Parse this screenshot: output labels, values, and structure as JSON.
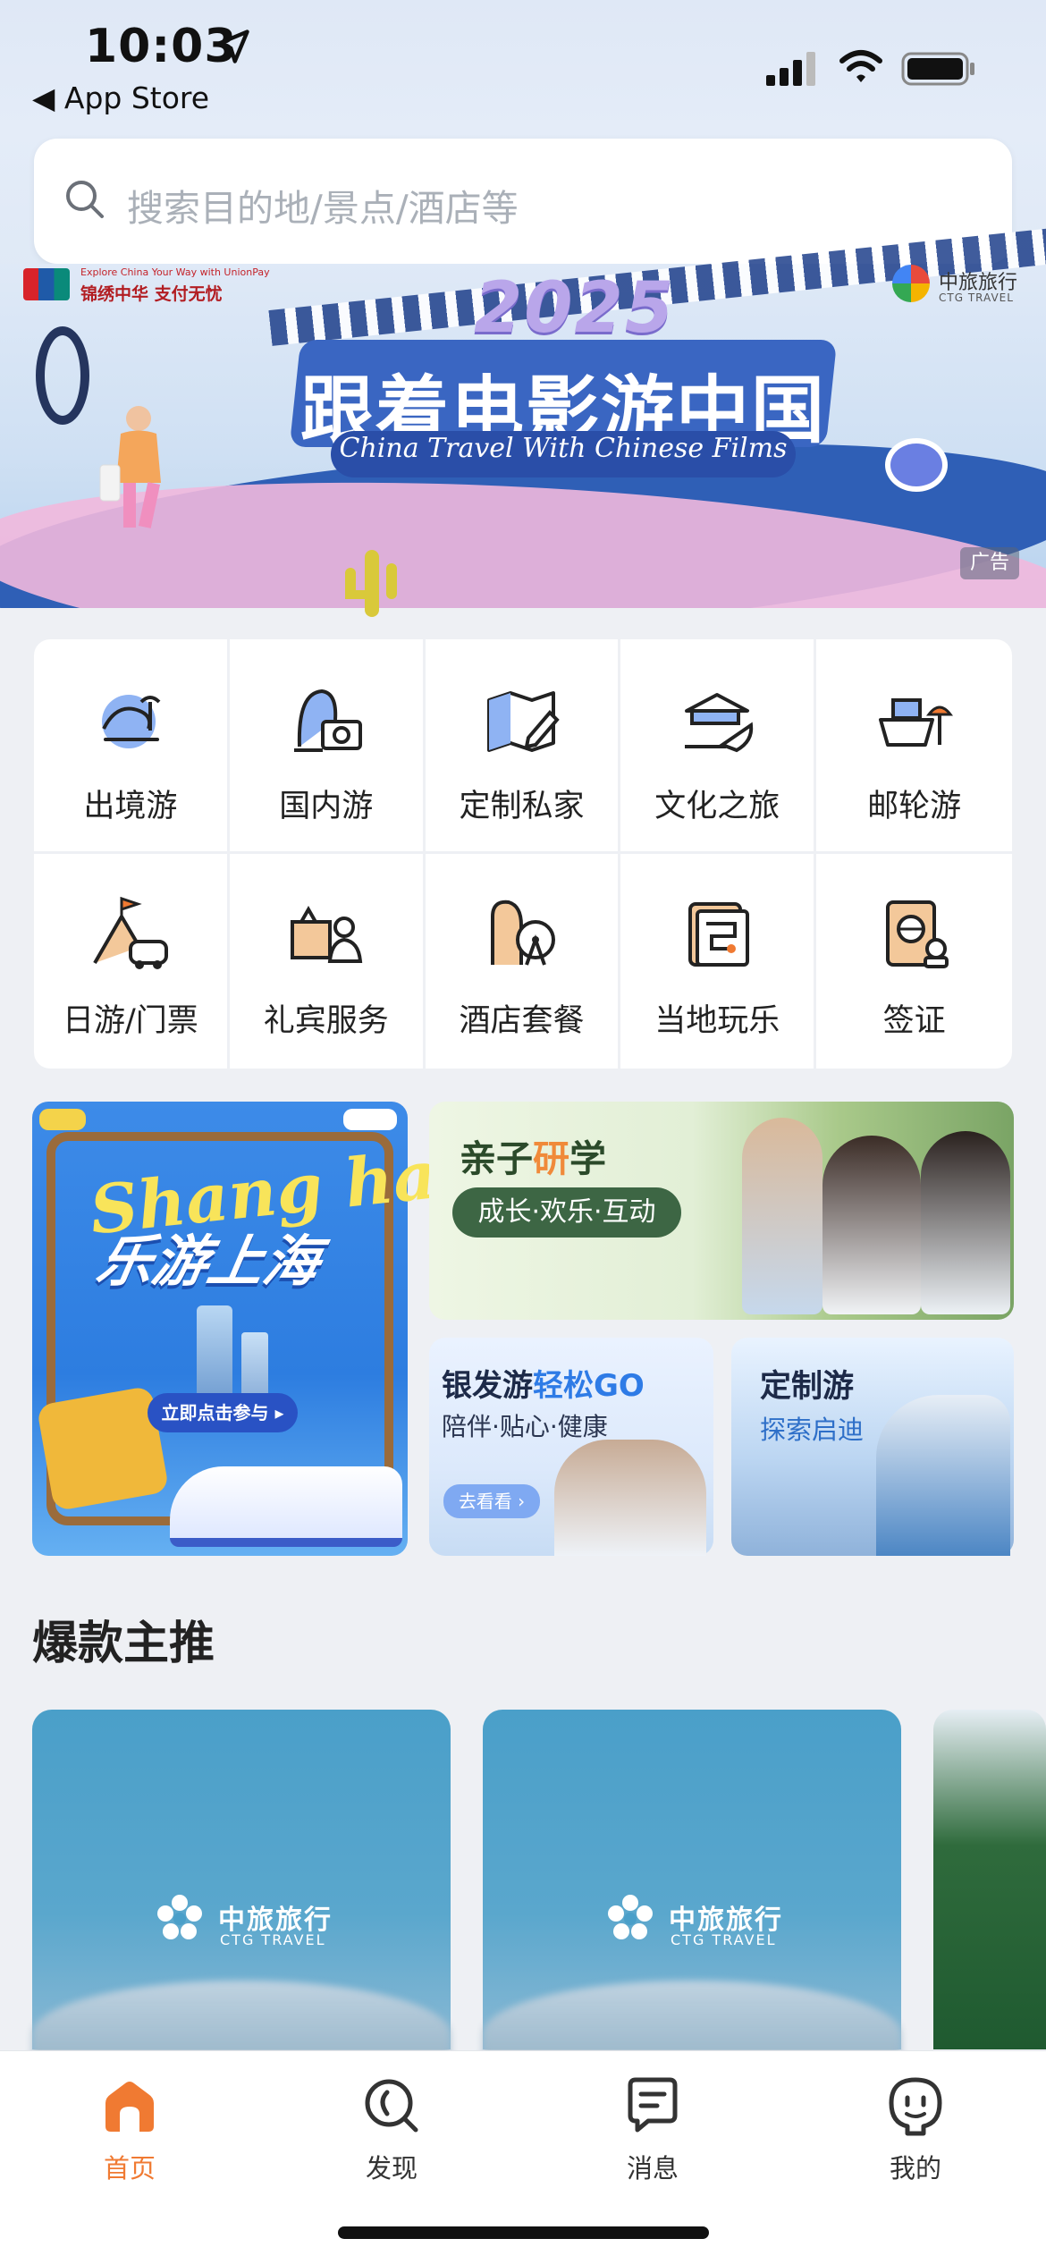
{
  "status": {
    "time": "10:03",
    "back_app": "◀ App Store"
  },
  "search": {
    "placeholder": "搜索目的地/景点/酒店等"
  },
  "banner": {
    "year": "2025",
    "title": "跟着电影游中国",
    "subtitle": "China Travel With Chinese Films",
    "unionpay_small": "Explore China Your Way with UnionPay",
    "unionpay_text": "锦绣中华  支付无忧",
    "brand": "中旅旅行",
    "brand_sub": "CTG TRAVEL",
    "ad_tag": "广告"
  },
  "categories": [
    {
      "label": "出境游",
      "icon": "wave-globe-icon"
    },
    {
      "label": "国内游",
      "icon": "camera-landscape-icon"
    },
    {
      "label": "定制私家",
      "icon": "map-pen-icon"
    },
    {
      "label": "文化之旅",
      "icon": "pavilion-fan-icon"
    },
    {
      "label": "邮轮游",
      "icon": "cruise-ship-icon"
    },
    {
      "label": "日游/门票",
      "icon": "mountain-car-icon"
    },
    {
      "label": "礼宾服务",
      "icon": "concierge-icon"
    },
    {
      "label": "酒店套餐",
      "icon": "ferris-wheel-icon"
    },
    {
      "label": "当地玩乐",
      "icon": "scroll-map-icon"
    },
    {
      "label": "签证",
      "icon": "passport-icon"
    }
  ],
  "promos": {
    "shanghai": {
      "script": "Shang hai",
      "title": "乐游上海",
      "button": "立即点击参与 ▸"
    },
    "family": {
      "title_a": "亲子",
      "title_b": "研",
      "title_c": "学",
      "tag": "成长·欢乐·互动"
    },
    "silver": {
      "title_a": "银发游",
      "title_b": "轻松GO",
      "sub": "陪伴·贴心·健康",
      "button": "去看看 ›"
    },
    "custom": {
      "title": "定制游",
      "sub": "探索启迪"
    }
  },
  "section": {
    "title": "爆款主推"
  },
  "products": [
    {
      "brand": "中旅旅行",
      "brand_sub": "CTG TRAVEL"
    },
    {
      "brand": "中旅旅行",
      "brand_sub": "CTG TRAVEL"
    }
  ],
  "tabbar": {
    "tabs": [
      {
        "label": "首页",
        "icon": "home-icon",
        "active": true
      },
      {
        "label": "发现",
        "icon": "discover-icon",
        "active": false
      },
      {
        "label": "消息",
        "icon": "message-icon",
        "active": false
      },
      {
        "label": "我的",
        "icon": "profile-icon",
        "active": false
      }
    ]
  },
  "colors": {
    "accent": "#f07a32",
    "brand_blue": "#3a66c2"
  }
}
